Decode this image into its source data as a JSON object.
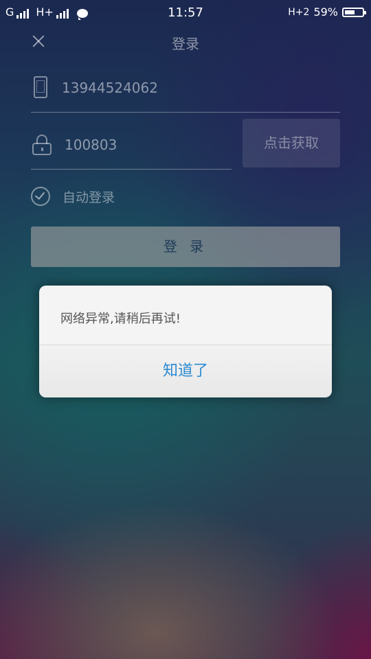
{
  "status_bar": {
    "carrier1": "G",
    "carrier2": "H+",
    "time": "11:57",
    "network_right": "H+2",
    "battery_percent": "59%",
    "battery_level": 0.59
  },
  "header": {
    "title": "登录"
  },
  "form": {
    "phone_value": "13944524062",
    "code_value": "100803",
    "get_code_label": "点击获取",
    "auto_login_label": "自动登录",
    "login_label": "登 录"
  },
  "dialog": {
    "message": "网络异常,请稍后再试!",
    "button_label": "知道了"
  },
  "colors": {
    "dialog_button": "#2b8ad1",
    "dialog_background": "#f4f4f4"
  }
}
